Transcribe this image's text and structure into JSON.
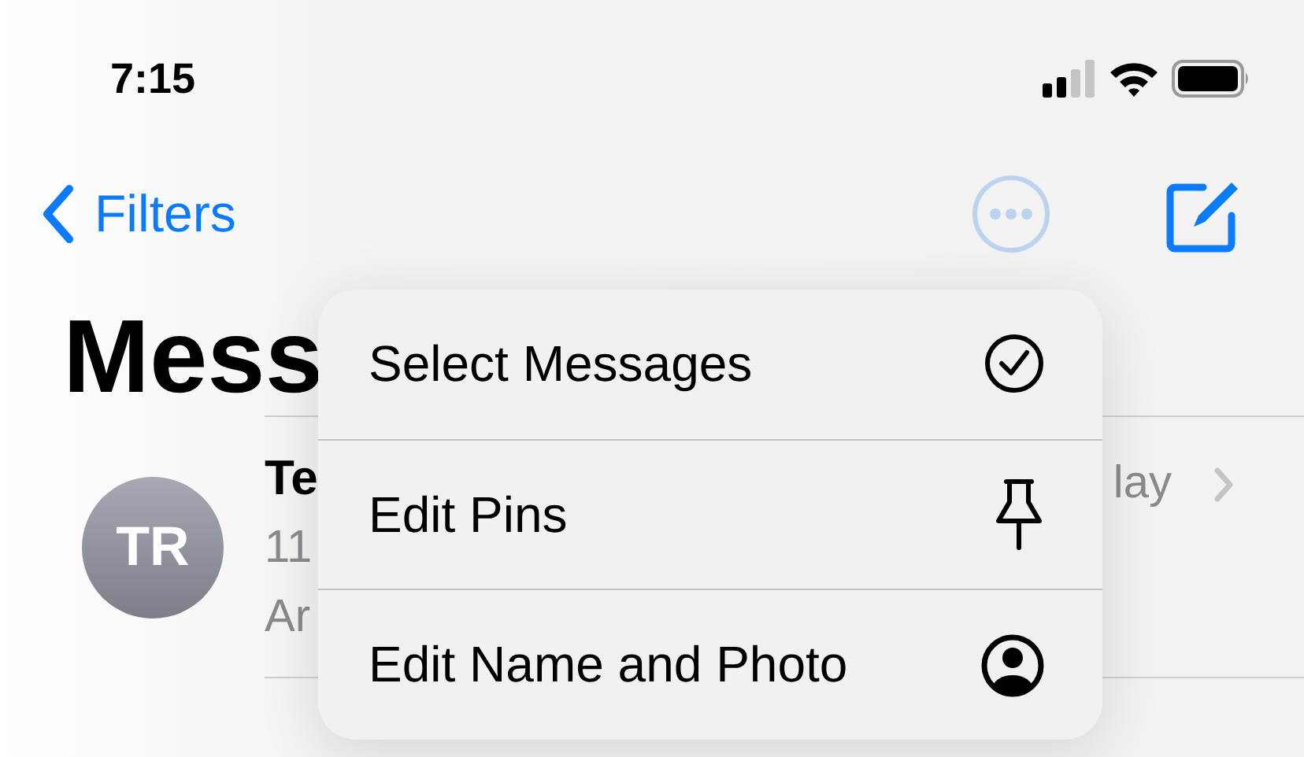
{
  "status_bar": {
    "time": "7:15"
  },
  "nav": {
    "back_label": "Filters"
  },
  "large_title": "Mess",
  "conversation": {
    "avatar_initials": "TR",
    "name": "Te",
    "line_1": "11",
    "line_2": "Ar",
    "date": "lay"
  },
  "menu": [
    {
      "label": "Select Messages",
      "kind": "check-circle"
    },
    {
      "label": "Edit Pins",
      "kind": "pin"
    },
    {
      "label": "Edit Name and Photo",
      "kind": "person-circle"
    }
  ]
}
